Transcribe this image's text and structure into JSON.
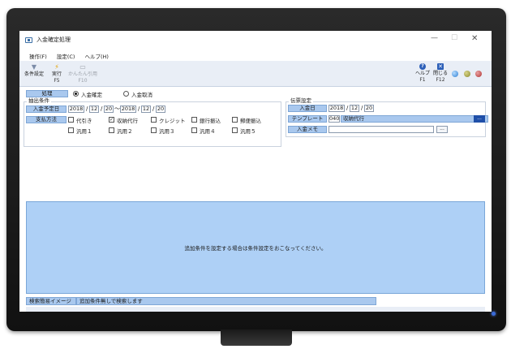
{
  "window": {
    "title": "入金確定処理"
  },
  "menu": [
    "操作(F)",
    "設定(C)",
    "ヘルプ(H)"
  ],
  "toolbar": {
    "filter": {
      "label": "条件設定",
      "key": ""
    },
    "run": {
      "label": "実行",
      "key": "F5"
    },
    "simple": {
      "label": "かんたん引用",
      "key": "F10"
    },
    "help": {
      "label": "ヘルプ",
      "key": "F1"
    },
    "close": {
      "label": "閉じる",
      "key": "F12"
    }
  },
  "process": {
    "label": "処理",
    "options": [
      {
        "label": "入金確定",
        "selected": true
      },
      {
        "label": "入金取消",
        "selected": false
      }
    ]
  },
  "extract": {
    "title": "抽出条件",
    "date_label": "入金予定日",
    "from": {
      "year": "2018",
      "month": "12",
      "day": "20"
    },
    "range_sep": "～",
    "to": {
      "year": "2018",
      "month": "12",
      "day": "20"
    },
    "pay_label": "支払方法",
    "methods": [
      {
        "label": "代引き",
        "checked": false
      },
      {
        "label": "収納代行",
        "checked": true
      },
      {
        "label": "クレジット",
        "checked": false
      },
      {
        "label": "銀行振込",
        "checked": false
      },
      {
        "label": "郵便振込",
        "checked": false
      },
      {
        "label": "汎用１",
        "checked": false
      },
      {
        "label": "汎用２",
        "checked": false
      },
      {
        "label": "汎用３",
        "checked": false
      },
      {
        "label": "汎用４",
        "checked": false
      },
      {
        "label": "汎用５",
        "checked": false
      }
    ]
  },
  "voucher": {
    "title": "伝票設定",
    "date_label": "入金日",
    "date": {
      "year": "2018",
      "month": "12",
      "day": "20"
    },
    "template_label": "テンプレート",
    "template_code": "040",
    "template_name": "収納代行",
    "memo_label": "入金メモ",
    "memo": ""
  },
  "date_sep": "/",
  "dots": "...",
  "panel_message": "追加条件を設定する場合は条件設定をおこなってください。",
  "summary": {
    "label": "検索簡易イメージ",
    "value": "追加条件無しで検索します"
  },
  "colors": {
    "panel": "#aed0f6",
    "label_bg": "#a9c8ee",
    "toolbar": "#e9eef6"
  }
}
